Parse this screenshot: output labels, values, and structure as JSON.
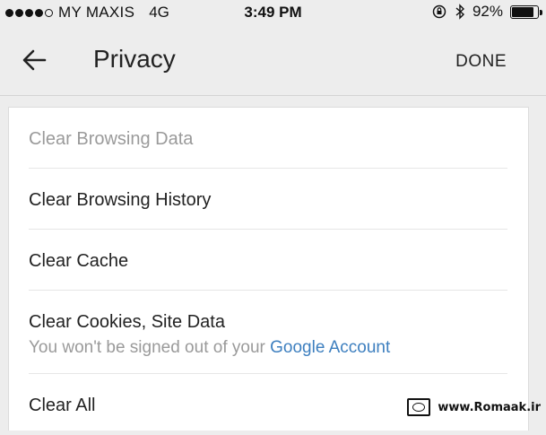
{
  "status_bar": {
    "carrier": "MY MAXIS",
    "network": "4G",
    "time": "3:49 PM",
    "battery": "92%",
    "battery_level": 0.92
  },
  "header": {
    "title": "Privacy",
    "done_label": "DONE"
  },
  "rows": {
    "clear_browsing_data": "Clear Browsing Data",
    "clear_browsing_history": "Clear Browsing History",
    "clear_cache": "Clear Cache",
    "clear_cookies": "Clear Cookies, Site Data",
    "clear_cookies_sub": "You won't be signed out of your ",
    "clear_cookies_link": "Google Account",
    "clear_all": "Clear All"
  },
  "colors": {
    "link": "#3d7fbf",
    "muted_text": "#9a9a9a",
    "background": "#ededed"
  },
  "watermark": {
    "text": "www.Romaak.ir"
  }
}
